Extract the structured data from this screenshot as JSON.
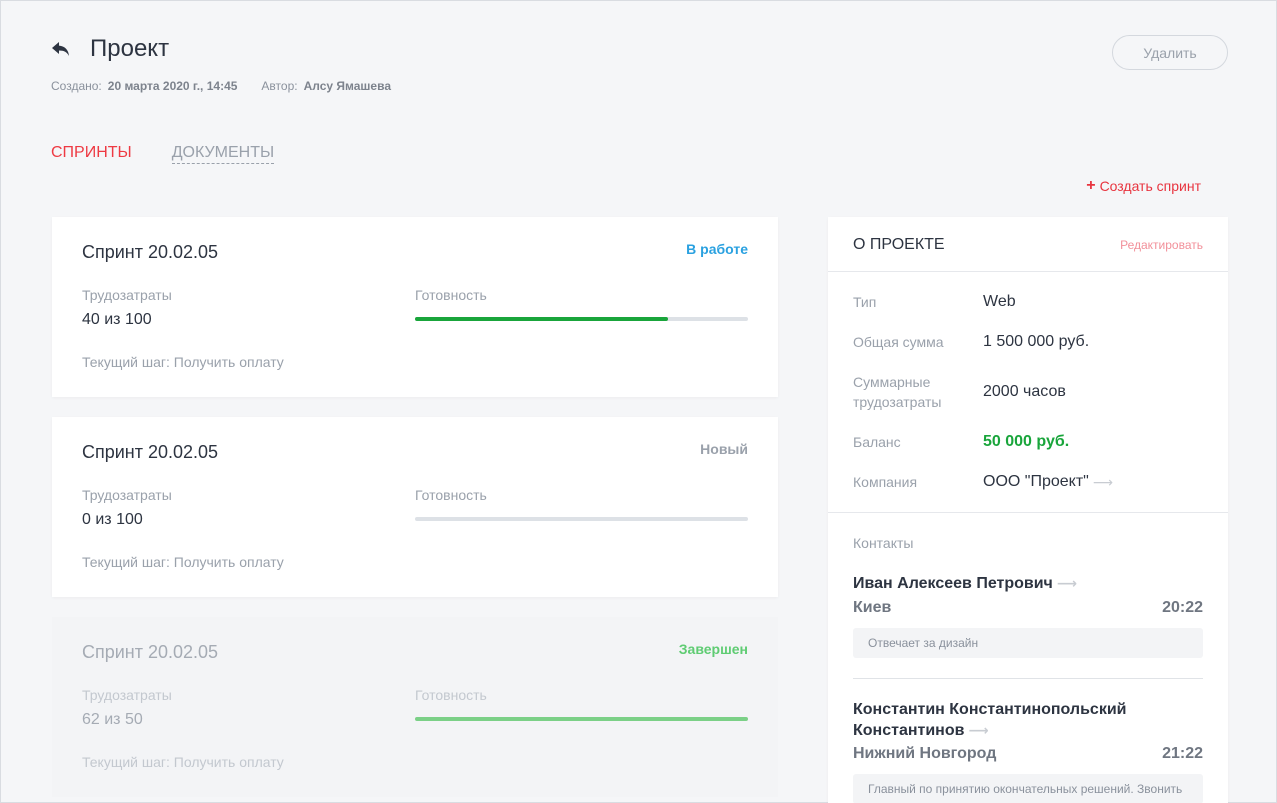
{
  "header": {
    "title": "Проект",
    "created_label": "Создано:",
    "created_value": "20 марта 2020 г., 14:45",
    "author_label": "Автор:",
    "author_value": "Алсу Ямашева",
    "delete_label": "Удалить"
  },
  "tabs": [
    {
      "label": "СПРИНТЫ",
      "active": true
    },
    {
      "label": "ДОКУМЕНТЫ",
      "active": false
    }
  ],
  "create_sprint_label": "Создать спринт",
  "sprints": [
    {
      "name": "Спринт 20.02.05",
      "status": "В работе",
      "status_color": "#2aa1e0",
      "effort_label": "Трудозатраты",
      "effort_value": "40 из 100",
      "readiness_label": "Готовность",
      "readiness": 0.76,
      "step": "Текущий шаг: Получить оплату"
    },
    {
      "name": "Спринт 20.02.05",
      "status": "Новый",
      "status_color": "#9aa1ab",
      "effort_label": "Трудозатраты",
      "effort_value": "0 из 100",
      "readiness_label": "Готовность",
      "readiness": 0,
      "step": "Текущий шаг: Получить оплату"
    },
    {
      "name": "Спринт 20.02.05",
      "status": "Завершен",
      "status_color": "#5fcc73",
      "effort_label": "Трудозатраты",
      "effort_value": "62 из 50",
      "readiness_label": "Готовность",
      "readiness": 1,
      "step": "Текущий шаг: Получить оплату"
    }
  ],
  "about": {
    "title": "О ПРОЕКТЕ",
    "edit_label": "Редактировать",
    "rows": [
      {
        "label": "Тип",
        "value": "Web"
      },
      {
        "label": "Общая сумма",
        "value": "1 500 000 руб."
      },
      {
        "label": "Суммарные трудозатраты",
        "value": "2000 часов"
      },
      {
        "label": "Баланс",
        "value": "50 000 руб."
      },
      {
        "label": "Компания",
        "value": "ООО \"Проект\""
      }
    ],
    "contacts_label": "Контакты",
    "contacts": [
      {
        "name": "Иван Алексеев Петрович",
        "city": "Киев",
        "time": "20:22",
        "note": "Отвечает за дизайн"
      },
      {
        "name": "Константин Константинопольский Константинов",
        "city": "Нижний Новгород",
        "time": "21:22",
        "note": "Главный по принятию окончательных решений. Звонить"
      }
    ]
  },
  "colors": {
    "accent": "#ee3a43",
    "green": "#19a53b",
    "blue": "#2aa1e0"
  }
}
